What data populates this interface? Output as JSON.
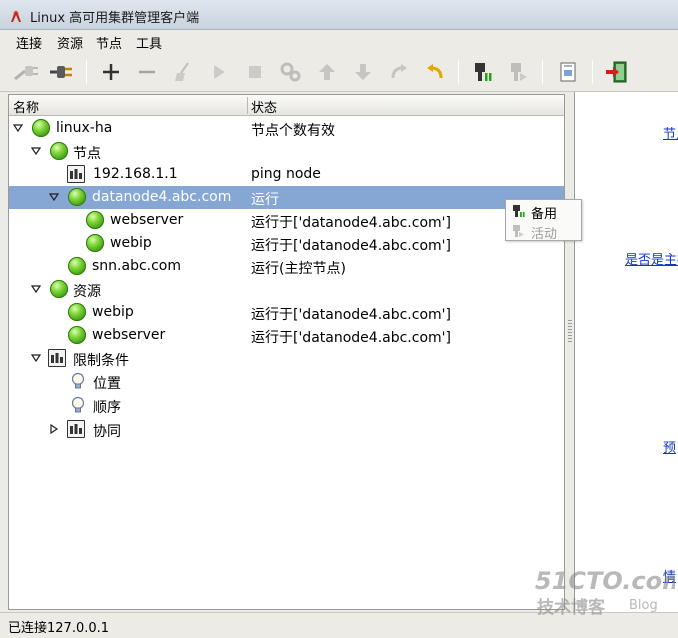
{
  "window": {
    "title": "Linux 高可用集群管理客户端"
  },
  "menu": [
    "连接",
    "资源",
    "节点",
    "工具"
  ],
  "tree": {
    "columns": [
      "名称",
      "状态"
    ],
    "rows": [
      {
        "name": "linux-ha",
        "status": "节点个数有效"
      },
      {
        "name": "节点",
        "status": ""
      },
      {
        "name": "192.168.1.1",
        "status": "ping node"
      },
      {
        "name": "datanode4.abc.com",
        "status": "运行"
      },
      {
        "name": "webserver",
        "status": "运行于['datanode4.abc.com']"
      },
      {
        "name": "webip",
        "status": "运行于['datanode4.abc.com']"
      },
      {
        "name": "snn.abc.com",
        "status": "运行(主控节点)"
      },
      {
        "name": "资源",
        "status": ""
      },
      {
        "name": "webip",
        "status": "运行于['datanode4.abc.com']"
      },
      {
        "name": "webserver",
        "status": "运行于['datanode4.abc.com']"
      },
      {
        "name": "限制条件",
        "status": ""
      },
      {
        "name": "位置",
        "status": ""
      },
      {
        "name": "顺序",
        "status": ""
      },
      {
        "name": "协同",
        "status": ""
      }
    ]
  },
  "popup": {
    "items": [
      "备用",
      "活动"
    ]
  },
  "right_panel": {
    "links": [
      "节点",
      "是否是主控",
      "预",
      "情"
    ]
  },
  "statusbar": {
    "text": "已连接127.0.0.1"
  },
  "watermark": {
    "main": "51CTO.com",
    "sub": "技术博客",
    "tag": "Blog"
  },
  "colors": {
    "selection": "#86a7d4",
    "link": "#1336c9",
    "node_online": "#4caf1f"
  },
  "icons": {
    "toolbar": [
      "connect-icon",
      "disconnect-icon",
      "add-icon",
      "remove-icon",
      "cleanup-icon",
      "start-icon",
      "stop-icon",
      "migrate-icon",
      "move-up-icon",
      "move-down-icon",
      "redo-icon",
      "undo-icon",
      "standby-icon",
      "active-icon",
      "document-icon",
      "exit-icon"
    ]
  }
}
